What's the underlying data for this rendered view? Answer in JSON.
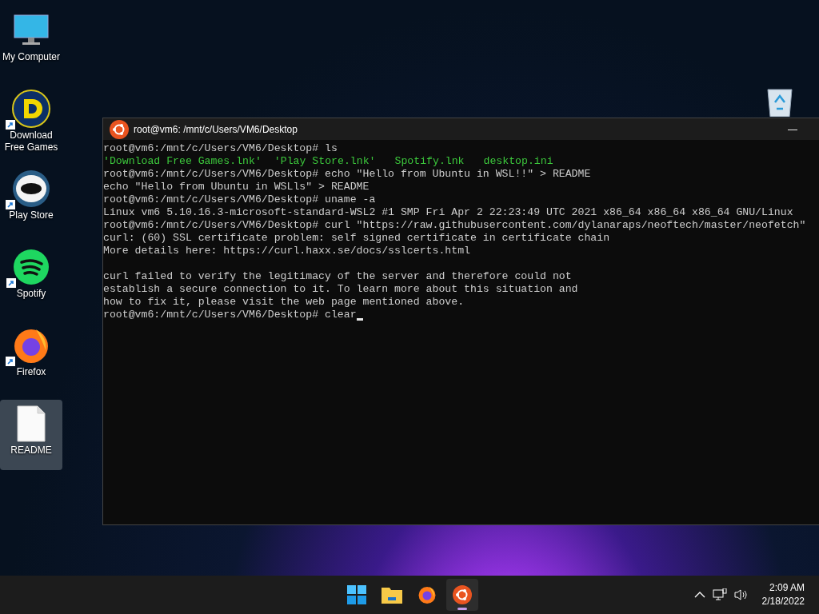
{
  "desktop_icons": [
    {
      "kind": "monitor",
      "label": "My Computer",
      "shortcut": false,
      "selected": false
    },
    {
      "kind": "disc",
      "label": "Download Free Games",
      "shortcut": true,
      "selected": false
    },
    {
      "kind": "helmet",
      "label": "Play Store",
      "shortcut": true,
      "selected": false
    },
    {
      "kind": "spotify",
      "label": "Spotify",
      "shortcut": true,
      "selected": false
    },
    {
      "kind": "firefox",
      "label": "Firefox",
      "shortcut": true,
      "selected": false
    },
    {
      "kind": "file",
      "label": "README",
      "shortcut": false,
      "selected": true
    }
  ],
  "terminal": {
    "title": "root@vm6: /mnt/c/Users/VM6/Desktop",
    "close": "—",
    "lines": [
      {
        "kind": "prompt",
        "text": "root@vm6:/mnt/c/Users/VM6/Desktop# ls",
        "cursor": false
      },
      {
        "kind": "files",
        "items": [
          "'Download Free Games.lnk'",
          "'Play Store.lnk'",
          "Spotify.lnk",
          "desktop.ini"
        ]
      },
      {
        "kind": "prompt",
        "text": "root@vm6:/mnt/c/Users/VM6/Desktop# echo \"Hello from Ubuntu in WSL!!\" > README",
        "cursor": false
      },
      {
        "kind": "output",
        "text": "echo \"Hello from Ubuntu in WSLls\" > README"
      },
      {
        "kind": "prompt",
        "text": "root@vm6:/mnt/c/Users/VM6/Desktop# uname -a",
        "cursor": false
      },
      {
        "kind": "output",
        "text": "Linux vm6 5.10.16.3-microsoft-standard-WSL2 #1 SMP Fri Apr 2 22:23:49 UTC 2021 x86_64 x86_64 x86_64 GNU/Linux"
      },
      {
        "kind": "prompt",
        "text": "root@vm6:/mnt/c/Users/VM6/Desktop# curl \"https://raw.githubusercontent.com/dylanaraps/neoftech/master/neofetch\"",
        "cursor": false
      },
      {
        "kind": "output",
        "text": "curl: (60) SSL certificate problem: self signed certificate in certificate chain"
      },
      {
        "kind": "output",
        "text": "More details here: https://curl.haxx.se/docs/sslcerts.html"
      },
      {
        "kind": "blank"
      },
      {
        "kind": "output",
        "text": "curl failed to verify the legitimacy of the server and therefore could not"
      },
      {
        "kind": "output",
        "text": "establish a secure connection to it. To learn more about this situation and"
      },
      {
        "kind": "output",
        "text": "how to fix it, please visit the web page mentioned above."
      },
      {
        "kind": "prompt",
        "text": "root@vm6:/mnt/c/Users/VM6/Desktop# clear",
        "cursor": true
      }
    ]
  },
  "taskbar": {
    "apps": [
      {
        "kind": "start",
        "selected": false
      },
      {
        "kind": "folder",
        "selected": false
      },
      {
        "kind": "firefox",
        "selected": false
      },
      {
        "kind": "ubuntu",
        "selected": true
      }
    ],
    "time": "2:09 AM",
    "date": "2/18/2022"
  }
}
